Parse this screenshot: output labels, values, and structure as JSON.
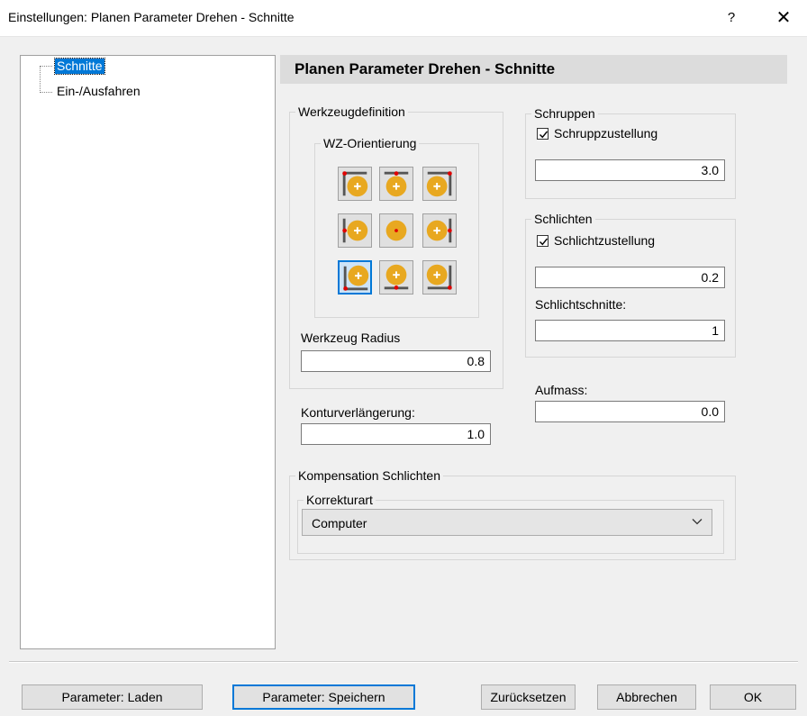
{
  "window": {
    "title": "Einstellungen: Planen Parameter Drehen - Schnitte",
    "help_label": "?",
    "close_label": "✕"
  },
  "tree": {
    "items": [
      {
        "label": "Schnitte",
        "selected": true
      },
      {
        "label": "Ein-/Ausfahren",
        "selected": false
      }
    ]
  },
  "header": {
    "title": "Planen Parameter Drehen - Schnitte"
  },
  "werkzeug": {
    "group_label": "Werkzeugdefinition",
    "orientation_label": "WZ-Orientierung",
    "orientation_selected": "bottom-left",
    "radius_label": "Werkzeug Radius",
    "radius_value": "0.8"
  },
  "kontur": {
    "label": "Konturverlängerung:",
    "value": "1.0"
  },
  "schruppen": {
    "group_label": "Schruppen",
    "checkbox_label": "Schruppzustellung",
    "checked": true,
    "value": "3.0"
  },
  "schlichten": {
    "group_label": "Schlichten",
    "checkbox_label": "Schlichtzustellung",
    "checked": true,
    "value": "0.2",
    "schnitte_label": "Schlichtschnitte:",
    "schnitte_value": "1"
  },
  "aufmass": {
    "label": "Aufmass:",
    "value": "0.0"
  },
  "kompensation": {
    "group_label": "Kompensation Schlichten",
    "korrektur_label": "Korrekturart",
    "selected": "Computer"
  },
  "buttons": {
    "laden": "Parameter: Laden",
    "speichern": "Parameter: Speichern",
    "zuruecksetzen": "Zurücksetzen",
    "abbrechen": "Abbrechen",
    "ok": "OK"
  },
  "colors": {
    "accent": "#0078d7",
    "tool_fill": "#e8a820",
    "tool_marker": "#e00000"
  }
}
